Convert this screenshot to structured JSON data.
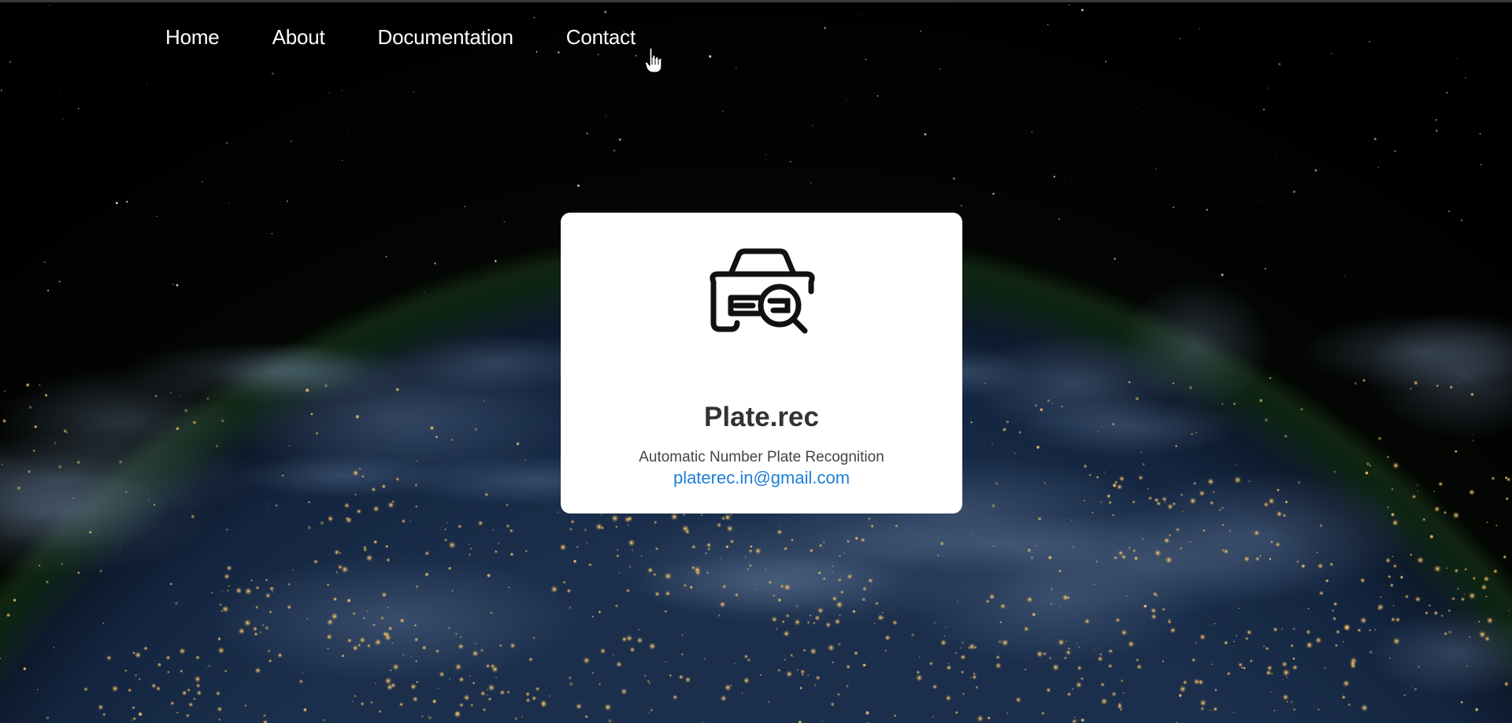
{
  "nav": {
    "items": [
      {
        "label": "Home"
      },
      {
        "label": "About"
      },
      {
        "label": "Documentation"
      },
      {
        "label": "Contact"
      }
    ]
  },
  "card": {
    "logo_icon": "car-search-icon",
    "title": "Plate.rec",
    "subtitle": "Automatic Number Plate Recognition",
    "email": "platerec.in@gmail.com"
  },
  "background": {
    "image": "earth-at-night-from-space",
    "cursor_icon": "hand-pointer-icon"
  },
  "colors": {
    "link": "#1f7fd8",
    "title": "#333333",
    "card_bg": "#ffffff",
    "nav_text": "#ffffff"
  }
}
